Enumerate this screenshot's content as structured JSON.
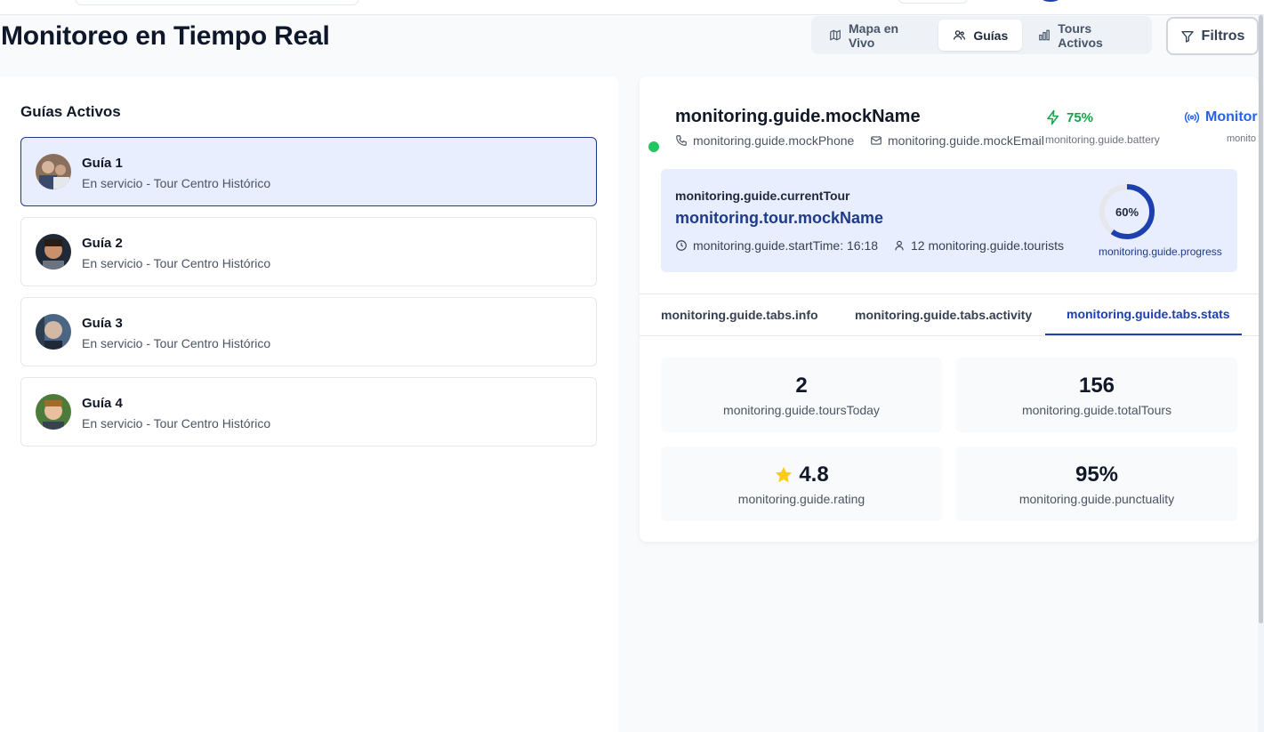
{
  "page": {
    "title": "Monitoreo en Tiempo Real"
  },
  "view_tabs": [
    {
      "label": "Mapa en Vivo",
      "icon": "map-icon"
    },
    {
      "label": "Guías",
      "icon": "users-icon",
      "active": true
    },
    {
      "label": "Tours Activos",
      "icon": "bar-chart-icon"
    }
  ],
  "filters": {
    "label": "Filtros",
    "icon": "filter-icon"
  },
  "guides_panel": {
    "title": "Guías Activos",
    "guides": [
      {
        "name": "Guía 1",
        "status": "En servicio - Tour Centro Histórico",
        "selected": true
      },
      {
        "name": "Guía 2",
        "status": "En servicio - Tour Centro Histórico"
      },
      {
        "name": "Guía 3",
        "status": "En servicio - Tour Centro Histórico"
      },
      {
        "name": "Guía 4",
        "status": "En servicio - Tour Centro Histórico"
      }
    ]
  },
  "detail": {
    "name": "monitoring.guide.mockName",
    "phone": "monitoring.guide.mockPhone",
    "email": "monitoring.guide.mockEmail",
    "battery_value": "75%",
    "battery_label": "monitoring.guide.battery",
    "monitor_value": "Monitor",
    "monitor_label": "monito",
    "online_color": "#22c55e",
    "tour": {
      "label": "monitoring.guide.currentTour",
      "name": "monitoring.tour.mockName",
      "start_time": "monitoring.guide.startTime: 16:18",
      "tourists": "12 monitoring.guide.tourists",
      "progress_text": "60%",
      "progress": 0.6,
      "progress_label": "monitoring.guide.progress"
    },
    "tabs": [
      {
        "label": "monitoring.guide.tabs.info"
      },
      {
        "label": "monitoring.guide.tabs.activity"
      },
      {
        "label": "monitoring.guide.tabs.stats",
        "active": true
      }
    ],
    "stats": [
      {
        "value": "2",
        "label": "monitoring.guide.toursToday"
      },
      {
        "value": "156",
        "label": "monitoring.guide.totalTours"
      },
      {
        "value": "4.8",
        "label": "monitoring.guide.rating",
        "icon": "star-icon"
      },
      {
        "value": "95%",
        "label": "monitoring.guide.punctuality"
      }
    ]
  },
  "colors": {
    "accent": "#1e40af",
    "selected_bg": "#e8eefd",
    "battery": "#16a34a",
    "monitor": "#2563eb",
    "star": "#facc15"
  }
}
